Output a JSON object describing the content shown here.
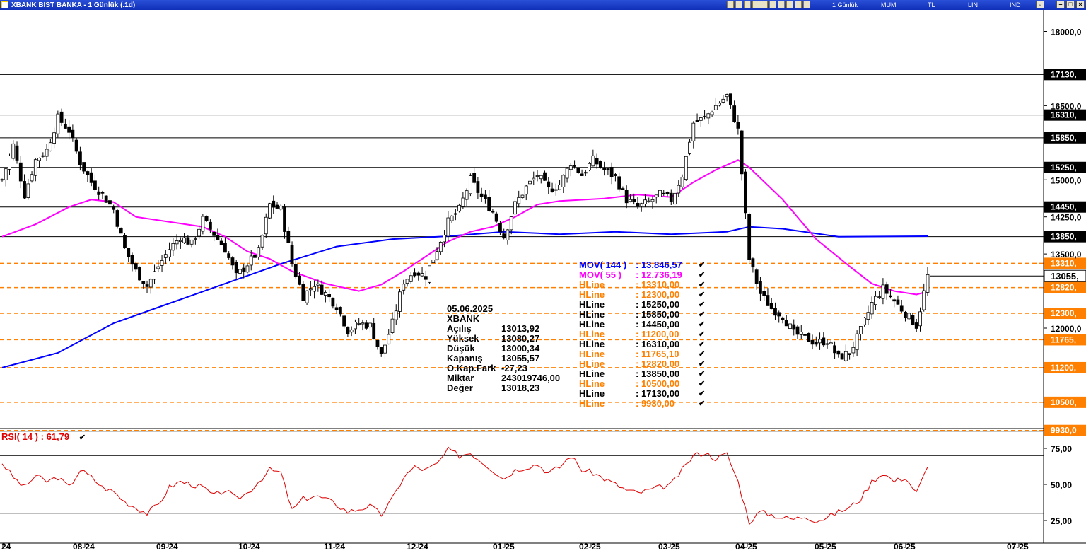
{
  "window": {
    "title": "XBANK BIST BANKA - 1 Günlük (.1d)",
    "options": [
      "1 Günlük",
      "MUM",
      "TL",
      "LIN",
      "IND"
    ]
  },
  "info_box": {
    "date": "05.06.2025",
    "symbol": "XBANK",
    "rows": [
      {
        "k": "Açılış",
        "v": "13013,92"
      },
      {
        "k": "Yüksek",
        "v": "13080,27"
      },
      {
        "k": "Düşük",
        "v": "13000,34"
      },
      {
        "k": "Kapanış",
        "v": "13055,57"
      },
      {
        "k": "O.Kap.Fark",
        "v": "-27,23"
      },
      {
        "k": "Miktar",
        "v": "243019746,00"
      },
      {
        "k": "Değer",
        "v": "13018,23"
      }
    ]
  },
  "legend": [
    {
      "name": "MOV( 144 )",
      "value": ": 13.846,57",
      "color": "#0000ff"
    },
    {
      "name": "MOV( 55 )",
      "value": ": 12.736,19",
      "color": "#ff00ff"
    },
    {
      "name": "HLine",
      "value": ": 13310,00",
      "color": "#ff8000"
    },
    {
      "name": "HLine",
      "value": ": 12300,00",
      "color": "#ff8000"
    },
    {
      "name": "HLine",
      "value": ": 15250,00",
      "color": "#000000"
    },
    {
      "name": "HLine",
      "value": ": 15850,00",
      "color": "#000000"
    },
    {
      "name": "HLine",
      "value": ": 14450,00",
      "color": "#000000"
    },
    {
      "name": "HLine",
      "value": ": 11200,00",
      "color": "#ff8000"
    },
    {
      "name": "HLine",
      "value": ": 16310,00",
      "color": "#000000"
    },
    {
      "name": "HLine",
      "value": ": 11765,10",
      "color": "#ff8000"
    },
    {
      "name": "HLine",
      "value": ": 12820,00",
      "color": "#ff8000"
    },
    {
      "name": "HLine",
      "value": ": 13850,00",
      "color": "#000000"
    },
    {
      "name": "HLine",
      "value": ": 10500,00",
      "color": "#ff8000"
    },
    {
      "name": "HLine",
      "value": ": 17130,00",
      "color": "#000000"
    },
    {
      "name": "HLine",
      "value": ": 9930,00",
      "color": "#ff8000"
    }
  ],
  "rsi": {
    "label": "RSI( 14 )",
    "value": ": 61,79"
  },
  "chart_data": [
    {
      "type": "candlestick",
      "title": "XBANK BIST BANKA - 1 Günlük (.1d)",
      "x_tick_labels": [
        "24",
        "08-24",
        "09-24",
        "10-24",
        "11-24",
        "12-24",
        "01-25",
        "02-25",
        "03-25",
        "04-25",
        "05-25",
        "06-25",
        "07-25"
      ],
      "y_tick_labels": [
        "18000,0",
        "16500,0",
        "15000,0",
        "14250,0",
        "13500,0",
        "12000,0"
      ],
      "ylim": [
        9930,
        18300
      ],
      "close_points": [
        [
          0,
          15000
        ],
        [
          3,
          15700
        ],
        [
          6,
          14700
        ],
        [
          9,
          15400
        ],
        [
          12,
          15600
        ],
        [
          15,
          16250
        ],
        [
          18,
          16000
        ],
        [
          21,
          15350
        ],
        [
          24,
          14950
        ],
        [
          27,
          14700
        ],
        [
          30,
          14400
        ],
        [
          33,
          13600
        ],
        [
          36,
          13150
        ],
        [
          39,
          12850
        ],
        [
          42,
          13250
        ],
        [
          45,
          13600
        ],
        [
          48,
          13850
        ],
        [
          51,
          13700
        ],
        [
          54,
          14200
        ],
        [
          57,
          13900
        ],
        [
          60,
          13600
        ],
        [
          63,
          13050
        ],
        [
          66,
          13300
        ],
        [
          69,
          13550
        ],
        [
          72,
          14500
        ],
        [
          75,
          14400
        ],
        [
          78,
          13300
        ],
        [
          81,
          12650
        ],
        [
          84,
          12900
        ],
        [
          87,
          12700
        ],
        [
          90,
          12450
        ],
        [
          93,
          11950
        ],
        [
          96,
          12100
        ],
        [
          99,
          12050
        ],
        [
          102,
          11450
        ],
        [
          105,
          12100
        ],
        [
          108,
          12950
        ],
        [
          111,
          13150
        ],
        [
          114,
          13050
        ],
        [
          117,
          13600
        ],
        [
          120,
          14150
        ],
        [
          123,
          14400
        ],
        [
          126,
          15000
        ],
        [
          129,
          14650
        ],
        [
          132,
          14350
        ],
        [
          135,
          13850
        ],
        [
          138,
          14500
        ],
        [
          141,
          14850
        ],
        [
          144,
          15100
        ],
        [
          147,
          14800
        ],
        [
          150,
          14900
        ],
        [
          153,
          15350
        ],
        [
          156,
          15100
        ],
        [
          159,
          15400
        ],
        [
          162,
          15200
        ],
        [
          165,
          15050
        ],
        [
          168,
          14600
        ],
        [
          171,
          14450
        ],
        [
          174,
          14550
        ],
        [
          177,
          14700
        ],
        [
          180,
          14600
        ],
        [
          183,
          15100
        ],
        [
          186,
          16150
        ],
        [
          189,
          16250
        ],
        [
          192,
          16500
        ],
        [
          195,
          16700
        ],
        [
          198,
          16000
        ],
        [
          201,
          13400
        ],
        [
          204,
          12700
        ],
        [
          207,
          12400
        ],
        [
          210,
          12250
        ],
        [
          213,
          11900
        ],
        [
          216,
          11800
        ],
        [
          219,
          11700
        ],
        [
          222,
          11750
        ],
        [
          225,
          11400
        ],
        [
          228,
          11500
        ],
        [
          231,
          11950
        ],
        [
          234,
          12500
        ],
        [
          237,
          12800
        ],
        [
          240,
          12550
        ],
        [
          243,
          12300
        ],
        [
          246,
          12050
        ],
        [
          249,
          13055
        ]
      ],
      "rsi_points": [
        [
          0,
          65
        ],
        [
          3,
          55
        ],
        [
          6,
          48
        ],
        [
          9,
          56
        ],
        [
          12,
          52
        ],
        [
          15,
          55
        ],
        [
          18,
          48
        ],
        [
          21,
          60
        ],
        [
          24,
          55
        ],
        [
          27,
          48
        ],
        [
          30,
          45
        ],
        [
          33,
          38
        ],
        [
          36,
          34
        ],
        [
          39,
          30
        ],
        [
          42,
          36
        ],
        [
          45,
          48
        ],
        [
          48,
          52
        ],
        [
          51,
          50
        ],
        [
          54,
          48
        ],
        [
          57,
          42
        ],
        [
          60,
          46
        ],
        [
          63,
          40
        ],
        [
          66,
          44
        ],
        [
          69,
          52
        ],
        [
          72,
          60
        ],
        [
          75,
          58
        ],
        [
          78,
          32
        ],
        [
          81,
          40
        ],
        [
          84,
          42
        ],
        [
          87,
          40
        ],
        [
          90,
          36
        ],
        [
          93,
          31
        ],
        [
          96,
          33
        ],
        [
          99,
          35
        ],
        [
          102,
          29
        ],
        [
          105,
          40
        ],
        [
          108,
          55
        ],
        [
          111,
          62
        ],
        [
          114,
          60
        ],
        [
          117,
          64
        ],
        [
          120,
          74
        ],
        [
          123,
          70
        ],
        [
          126,
          72
        ],
        [
          129,
          66
        ],
        [
          132,
          60
        ],
        [
          135,
          54
        ],
        [
          138,
          60
        ],
        [
          141,
          62
        ],
        [
          144,
          64
        ],
        [
          147,
          58
        ],
        [
          150,
          62
        ],
        [
          153,
          70
        ],
        [
          156,
          60
        ],
        [
          159,
          58
        ],
        [
          162,
          54
        ],
        [
          165,
          50
        ],
        [
          168,
          46
        ],
        [
          171,
          44
        ],
        [
          174,
          46
        ],
        [
          177,
          48
        ],
        [
          180,
          50
        ],
        [
          183,
          60
        ],
        [
          186,
          70
        ],
        [
          189,
          72
        ],
        [
          192,
          68
        ],
        [
          195,
          71
        ],
        [
          198,
          52
        ],
        [
          201,
          24
        ],
        [
          204,
          31
        ],
        [
          207,
          29
        ],
        [
          210,
          27
        ],
        [
          213,
          26
        ],
        [
          216,
          28
        ],
        [
          219,
          25
        ],
        [
          222,
          27
        ],
        [
          225,
          31
        ],
        [
          228,
          34
        ],
        [
          231,
          40
        ],
        [
          234,
          52
        ],
        [
          237,
          58
        ],
        [
          240,
          52
        ],
        [
          243,
          55
        ],
        [
          246,
          44
        ],
        [
          249,
          62
        ]
      ],
      "series": [
        {
          "name": "MOV( 144 )",
          "color": "#0000ff",
          "points": [
            [
              0,
              11200
            ],
            [
              15,
              11500
            ],
            [
              30,
              12100
            ],
            [
              45,
              12500
            ],
            [
              60,
              12900
            ],
            [
              75,
              13300
            ],
            [
              90,
              13650
            ],
            [
              105,
              13800
            ],
            [
              120,
              13860
            ],
            [
              135,
              13950
            ],
            [
              150,
              13900
            ],
            [
              165,
              13950
            ],
            [
              180,
              13900
            ],
            [
              195,
              13950
            ],
            [
              201,
              14050
            ],
            [
              210,
              14010
            ],
            [
              225,
              13850
            ],
            [
              249,
              13860
            ]
          ]
        },
        {
          "name": "MOV( 55 )",
          "color": "#ff00ff",
          "points": [
            [
              0,
              13850
            ],
            [
              9,
              14100
            ],
            [
              18,
              14450
            ],
            [
              24,
              14600
            ],
            [
              30,
              14550
            ],
            [
              36,
              14250
            ],
            [
              45,
              14150
            ],
            [
              54,
              14050
            ],
            [
              60,
              13850
            ],
            [
              66,
              13550
            ],
            [
              72,
              13400
            ],
            [
              78,
              13150
            ],
            [
              87,
              12900
            ],
            [
              96,
              12750
            ],
            [
              102,
              12880
            ],
            [
              108,
              13150
            ],
            [
              114,
              13450
            ],
            [
              120,
              13750
            ],
            [
              126,
              13950
            ],
            [
              132,
              14050
            ],
            [
              138,
              14250
            ],
            [
              144,
              14500
            ],
            [
              150,
              14570
            ],
            [
              162,
              14620
            ],
            [
              171,
              14700
            ],
            [
              180,
              14650
            ],
            [
              186,
              14950
            ],
            [
              192,
              15200
            ],
            [
              198,
              15400
            ],
            [
              201,
              15250
            ],
            [
              210,
              14600
            ],
            [
              219,
              13800
            ],
            [
              228,
              13250
            ],
            [
              234,
              12900
            ],
            [
              240,
              12750
            ],
            [
              246,
              12680
            ],
            [
              249,
              12740
            ]
          ]
        }
      ],
      "hlines": [
        {
          "value": 17130,
          "label": "17130,",
          "style": "solid",
          "color": "#000000"
        },
        {
          "value": 16310,
          "label": "16310,",
          "style": "solid",
          "color": "#000000"
        },
        {
          "value": 15850,
          "label": "15850,",
          "style": "solid",
          "color": "#000000"
        },
        {
          "value": 15250,
          "label": "15250,",
          "style": "solid",
          "color": "#000000"
        },
        {
          "value": 14450,
          "label": "14450,",
          "style": "solid",
          "color": "#000000"
        },
        {
          "value": 13850,
          "label": "13850,",
          "style": "solid",
          "color": "#000000"
        },
        {
          "value": 13310,
          "label": "13310,",
          "style": "dashed",
          "color": "#ff8000"
        },
        {
          "value": 12820,
          "label": "12820,",
          "style": "dashed",
          "color": "#ff8000"
        },
        {
          "value": 12300,
          "label": "12300,",
          "style": "dashed",
          "color": "#ff8000"
        },
        {
          "value": 11765.1,
          "label": "11765,",
          "style": "dashed",
          "color": "#ff8000"
        },
        {
          "value": 11200,
          "label": "11200,",
          "style": "dashed",
          "color": "#ff8000"
        },
        {
          "value": 10500,
          "label": "10500,",
          "style": "dashed",
          "color": "#ff8000"
        },
        {
          "value": 9930,
          "label": "9930,0",
          "style": "dashed",
          "color": "#ff8000"
        }
      ],
      "last_price": {
        "value": 13055.57,
        "label": "13055,"
      }
    },
    {
      "type": "line",
      "title": "RSI( 14 )",
      "y_tick_labels": [
        "75,00",
        "50,00",
        "25,00"
      ],
      "ylim": [
        15,
        82
      ],
      "levels": [
        70,
        30
      ],
      "current_value": 61.79
    }
  ]
}
